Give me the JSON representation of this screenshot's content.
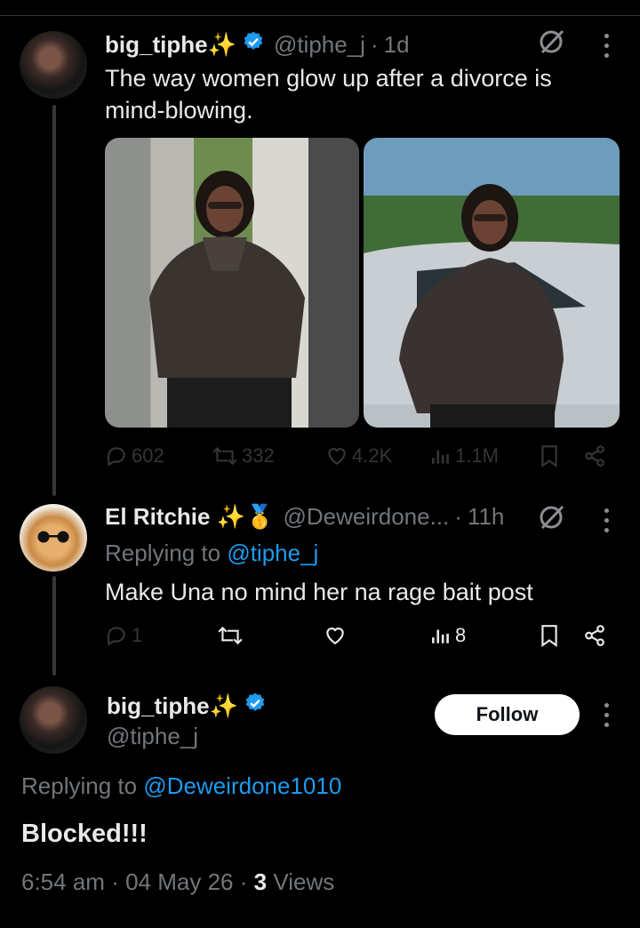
{
  "tweet1": {
    "display_name": "big_tiphe✨",
    "handle": "@tiphe_j",
    "time": "1d",
    "text_line1": "The way women glow up after a divorce is",
    "text_line2": "mind-blowing.",
    "stats": {
      "replies": "602",
      "reposts": "332",
      "likes": "4.2K",
      "views": "1.1M"
    }
  },
  "tweet2": {
    "display_name": "El Ritchie ✨🥇",
    "handle": "@Deweirdone...",
    "time": "11h",
    "replying_label": "Replying to",
    "replying_to": "@tiphe_j",
    "text": "Make Una no mind her na rage bait post",
    "stats": {
      "replies": "1",
      "reposts": "",
      "likes": "",
      "views": "8"
    }
  },
  "tweet3": {
    "display_name": "big_tiphe✨",
    "handle": "@tiphe_j",
    "follow_label": "Follow",
    "replying_label": "Replying to",
    "replying_to": "@Deweirdone1010",
    "text": "Blocked!!!",
    "time": "6:54 am",
    "date": "04 May 26",
    "views_count": "3",
    "views_label": "Views"
  },
  "colors": {
    "accent": "#1d9bf0",
    "muted": "#71767b",
    "background": "#000000"
  }
}
